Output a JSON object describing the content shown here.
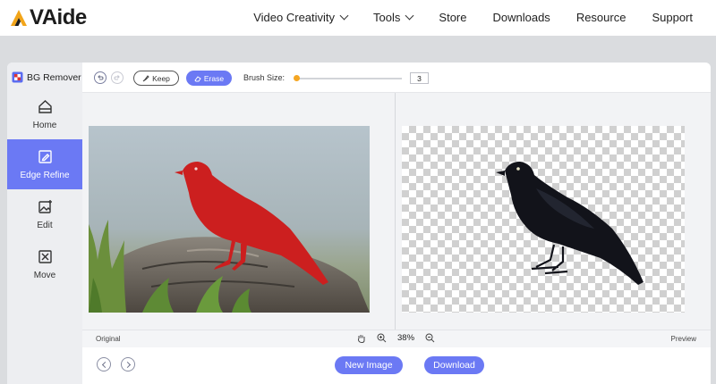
{
  "brand": {
    "name": "VAide",
    "logo_letter": "A"
  },
  "nav": {
    "items": [
      {
        "label": "Video Creativity",
        "has_dropdown": true
      },
      {
        "label": "Tools",
        "has_dropdown": true
      },
      {
        "label": "Store",
        "has_dropdown": false
      },
      {
        "label": "Downloads",
        "has_dropdown": false
      },
      {
        "label": "Resource",
        "has_dropdown": false
      },
      {
        "label": "Support",
        "has_dropdown": false
      }
    ]
  },
  "sidebar": {
    "title": "BG Remover",
    "items": [
      {
        "label": "Home",
        "icon": "home-icon",
        "active": false
      },
      {
        "label": "Edge Refine",
        "icon": "edge-refine-icon",
        "active": true
      },
      {
        "label": "Edit",
        "icon": "edit-image-icon",
        "active": false
      },
      {
        "label": "Move",
        "icon": "move-icon",
        "active": false
      }
    ]
  },
  "toolbar": {
    "keep_label": "Keep",
    "erase_label": "Erase",
    "brush_label": "Brush Size:",
    "brush_value": "3",
    "brush_fraction": 0.0
  },
  "status": {
    "original_label": "Original",
    "preview_label": "Preview",
    "zoom": "38%"
  },
  "footer": {
    "new_image_label": "New Image",
    "download_label": "Download"
  },
  "colors": {
    "accent": "#6b79f4",
    "slider_thumb": "#f5a623",
    "mask_red": "#cc1f1f"
  }
}
